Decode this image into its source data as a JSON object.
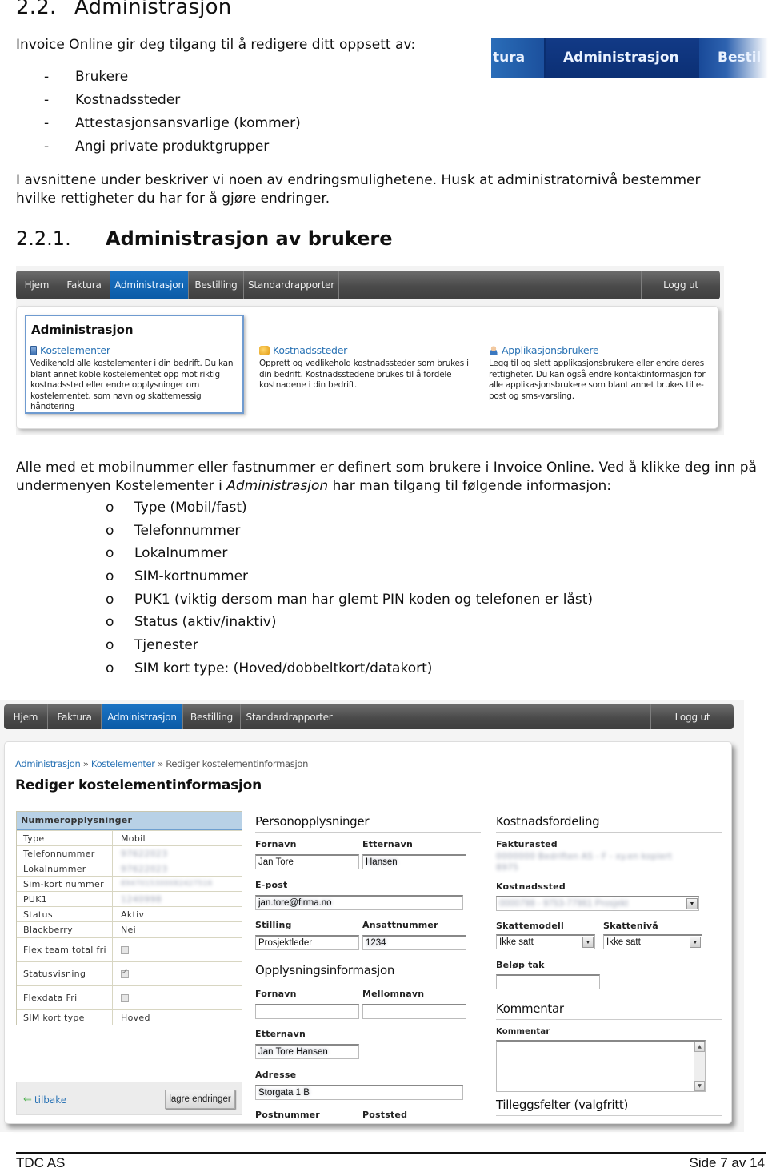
{
  "section": {
    "number": "2.2.",
    "title": "Administrasjon"
  },
  "intro": "Invoice Online gir deg tilgang til å redigere ditt oppsett av:",
  "dash_items": [
    "Brukere",
    "Kostnadssteder",
    "Attestasjonsansvarlige (kommer)",
    "Angi private produktgrupper"
  ],
  "dash_symbol": "-",
  "para1": "I avsnittene under beskriver vi noen av endringsmulighetene. Husk at administratornivå bestemmer hvilke rettigheter du har for å gjøre endringer.",
  "teaser": {
    "left": "tura",
    "active": "Administrasjon",
    "right": "Bestil"
  },
  "subsection": {
    "number": "2.2.1.",
    "title": "Administrasjon av brukere"
  },
  "shot1": {
    "nav": [
      "Hjem",
      "Faktura",
      "Administrasjon",
      "Bestilling",
      "Standardrapporter"
    ],
    "logout": "Logg ut",
    "box_title": "Administrasjon",
    "cards": [
      {
        "title": "Kostelementer",
        "text": "Vedikehold alle kostelementer i din bedrift. Du kan blant annet koble kostelementet opp mot riktig kostnadssted eller endre opplysninger om kostelementet, som navn og skattemessig håndtering"
      },
      {
        "title": "Kostnadssteder",
        "text": "Opprett og vedlikehold kostnadssteder som brukes i din bedrift. Kostnadsstedene brukes til å fordele kostnadene i din bedrift."
      },
      {
        "title": "Applikasjonsbrukere",
        "text": "Legg til og slett applikasjonsbrukere eller endre deres rettigheter. Du kan også endre kontaktinformasjon for alle applikasjonsbrukere som blant annet brukes til e-post og sms-varsling."
      }
    ]
  },
  "para2": {
    "before": "Alle med et mobilnummer eller fastnummer er definert som brukere i Invoice Online. Ved å klikke deg inn på undermenyen Kostelementer i ",
    "emph": "Administrasjon",
    "after": " har man tilgang til følgende informasjon:"
  },
  "o_symbol": "o",
  "o_items": [
    "Type (Mobil/fast)",
    "Telefonnummer",
    "Lokalnummer",
    "SIM-kortnummer",
    "PUK1 (viktig dersom man har glemt PIN koden og telefonen er låst)",
    "Status (aktiv/inaktiv)",
    "Tjenester",
    "SIM kort type: (Hoved/dobbeltkort/datakort)"
  ],
  "shot2": {
    "nav": [
      "Hjem",
      "Faktura",
      "Administrasjon",
      "Bestilling",
      "Standardrapporter"
    ],
    "logout": "Logg ut",
    "breadcrumb": [
      "Administrasjon",
      "Kostelementer",
      "Rediger kostelementinformasjon"
    ],
    "breadcrumb_sep": "»",
    "title": "Rediger kostelementinformasjon",
    "table": {
      "header": "Nummeropplysninger",
      "rows": [
        {
          "k": "Type",
          "v": "Mobil"
        },
        {
          "k": "Telefonnummer",
          "v": "97622023",
          "blur": true
        },
        {
          "k": "Lokalnummer",
          "v": "97622023",
          "blur": true
        },
        {
          "k": "Sim-kort nummer",
          "v": "8947015300082427516",
          "blur": true
        },
        {
          "k": "PUK1",
          "v": "1240998",
          "blur": true
        },
        {
          "k": "Status",
          "v": "Aktiv"
        },
        {
          "k": "Blackberry",
          "v": "Nei"
        },
        {
          "k": "Flex team total fri",
          "checkbox": false
        },
        {
          "k": "Statusvisning",
          "checkbox": true
        },
        {
          "k": "Flexdata Fri",
          "checkbox": false
        },
        {
          "k": "SIM kort type",
          "v": "Hoved"
        }
      ]
    },
    "back_label": "tilbake",
    "save_label": "lagre endringer",
    "person": {
      "heading": "Personopplysninger",
      "fornavn_label": "Fornavn",
      "fornavn": "Jan Tore",
      "etternavn_label": "Etternavn",
      "etternavn": "Hansen",
      "epost_label": "E-post",
      "epost": "jan.tore@firma.no",
      "stilling_label": "Stilling",
      "stilling": "Prosjektleder",
      "ansatt_label": "Ansattnummer",
      "ansatt": "1234"
    },
    "info": {
      "heading": "Opplysningsinformasjon",
      "fornavn_label": "Fornavn",
      "mellomnavn_label": "Mellomnavn",
      "etternavn_label": "Etternavn",
      "etternavn": "Jan Tore Hansen",
      "adresse_label": "Adresse",
      "adresse": "Storgata 1 B",
      "postnummer_label": "Postnummer",
      "poststed_label": "Poststed"
    },
    "cost": {
      "heading": "Kostnadsfordeling",
      "fakturasted_label": "Fakturasted",
      "fakturasted": "0000000 Bedriften AS - F - xy.en kopiert 8975",
      "kostnadssted_label": "Kostnadssted",
      "kostnadssted": "0000798 - 9753-77961 Prosjekt",
      "skattemodell_label": "Skattemodell",
      "skattemodell": "Ikke satt",
      "skatteniva_label": "Skattenivå",
      "skatteniva": "Ikke satt",
      "belop_label": "Beløp tak"
    },
    "comment": {
      "heading": "Kommentar",
      "label": "Kommentar"
    },
    "extra_heading": "Tilleggsfelter (valgfritt)"
  },
  "footer": {
    "company": "TDC AS",
    "page": "Side 7 av 14"
  }
}
